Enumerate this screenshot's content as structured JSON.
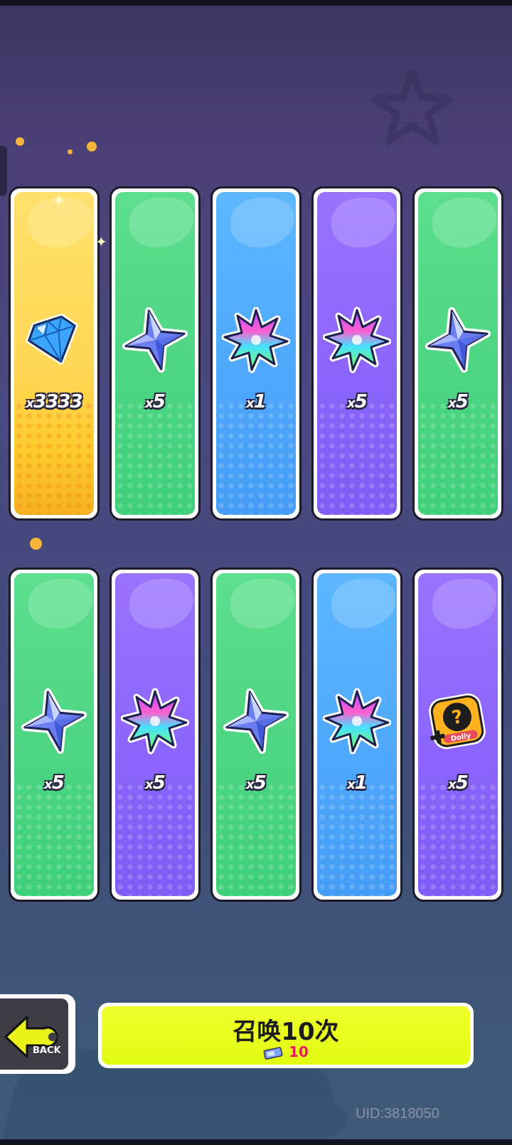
{
  "cards": [
    {
      "color": "gold",
      "icon": "diamond-icon",
      "qty": "3333"
    },
    {
      "color": "green",
      "icon": "blue-star-crystal-icon",
      "qty": "5"
    },
    {
      "color": "blue",
      "icon": "rainbow-star-icon",
      "qty": "1"
    },
    {
      "color": "purple",
      "icon": "rainbow-star-icon",
      "qty": "5"
    },
    {
      "color": "green",
      "icon": "blue-star-crystal-icon",
      "qty": "5"
    },
    {
      "color": "green",
      "icon": "blue-star-crystal-icon",
      "qty": "5"
    },
    {
      "color": "purple",
      "icon": "rainbow-star-icon",
      "qty": "5"
    },
    {
      "color": "green",
      "icon": "blue-star-crystal-icon",
      "qty": "5"
    },
    {
      "color": "blue",
      "icon": "rainbow-star-icon",
      "qty": "1"
    },
    {
      "color": "purple",
      "icon": "mystery-badge-icon",
      "qty": "5"
    }
  ],
  "qty_prefix": "x",
  "back_label": "BACK",
  "summon": {
    "title": "召唤10次",
    "cost": "10",
    "ticket_icon": "summon-ticket-icon"
  },
  "uid": "UID:3818050",
  "badge_text": "Dolly",
  "colors": {
    "accent_yellow": "#e8fd1a",
    "cost_red": "#e51d5a",
    "gold": "#ffd755",
    "green": "#4fd684",
    "blue": "#4ea7fb",
    "purple": "#8a64fb"
  }
}
